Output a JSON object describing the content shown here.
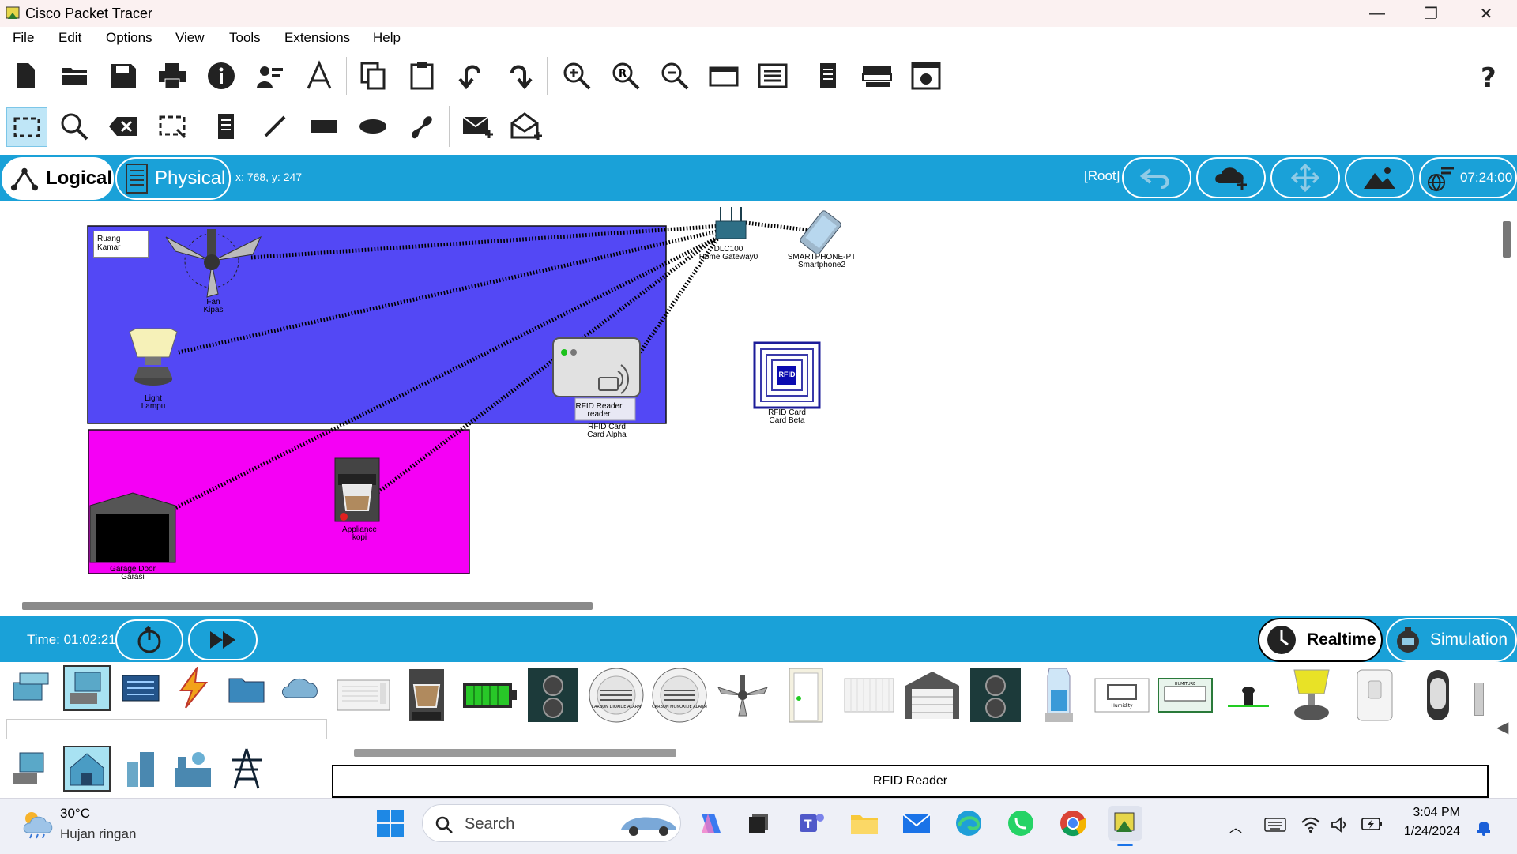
{
  "window": {
    "title": "Cisco Packet Tracer"
  },
  "menu": [
    "File",
    "Edit",
    "Options",
    "View",
    "Tools",
    "Extensions",
    "Help"
  ],
  "modebar": {
    "logical_label": "Logical",
    "physical_label": "Physical",
    "coords": "x: 768, y: 247",
    "root_label": "[Root]",
    "clock": "07:24:00"
  },
  "workspace": {
    "room_label": "Ruang Kamar",
    "devices": {
      "fan": {
        "line1": "Fan",
        "line2": "Kipas"
      },
      "light": {
        "line1": "Light",
        "line2": "Lampu"
      },
      "gateway": {
        "line1": "DLC100",
        "line2": "Home Gateway0"
      },
      "smartphone": {
        "line1": "SMARTPHONE-PT",
        "line2": "Smartphone2"
      },
      "rfid_reader": {
        "line1": "RFID Reader",
        "line2": "reader"
      },
      "card_alpha": {
        "line1": "RFID Card",
        "line2": "Card Alpha"
      },
      "card_beta": {
        "line1": "RFID Card",
        "line2": "Card Beta",
        "icon_text": "RFID"
      },
      "appliance": {
        "line1": "Appliance",
        "line2": "kopi"
      },
      "garage": {
        "line1": "Garage Door",
        "line2": "Garasi"
      }
    },
    "colors": {
      "room_blue": "#5348f5",
      "room_magenta": "#f500f5"
    }
  },
  "timebar": {
    "time": "Time: 01:02:21",
    "realtime_label": "Realtime",
    "simulation_label": "Simulation"
  },
  "device_panel": {
    "selected_device_name": "RFID Reader",
    "palette_labels": {
      "co2_alarm": "CARBON DIOXIDE ALARM",
      "co_alarm": "CARBON MONOXIDE ALARM",
      "humidity": "Humidity",
      "humiture": "HUMITURE"
    }
  },
  "taskbar": {
    "weather_temp": "30°C",
    "weather_desc": "Hujan ringan",
    "search_placeholder": "Search",
    "time": "3:04 PM",
    "date": "1/24/2024"
  }
}
